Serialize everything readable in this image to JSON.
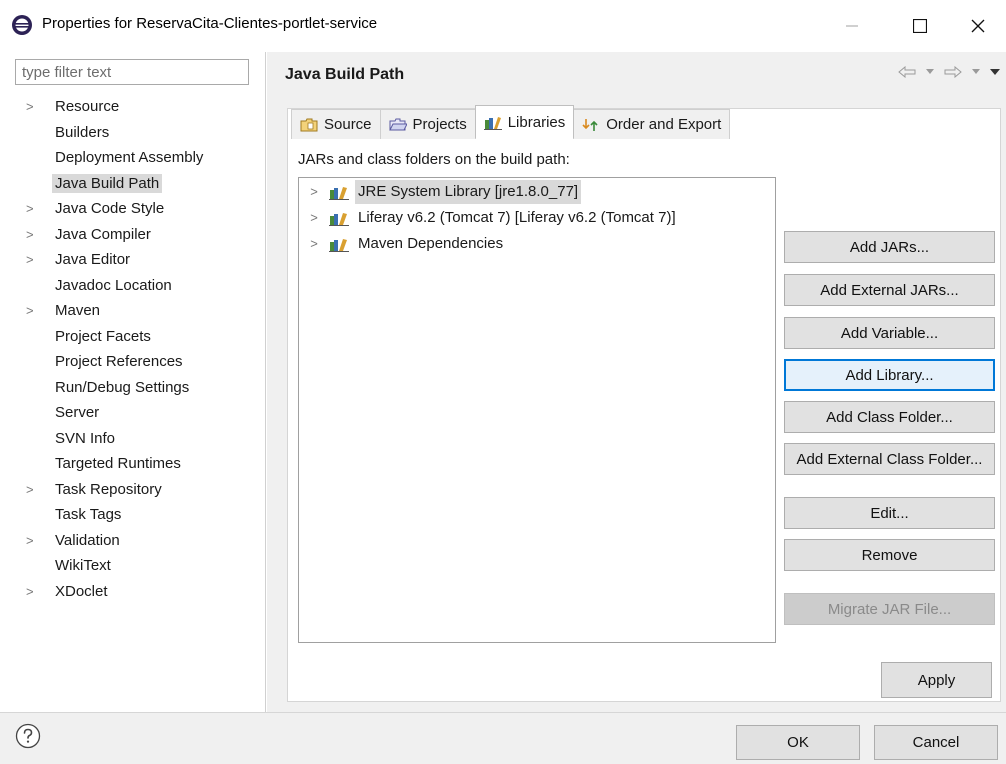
{
  "window": {
    "title": "Properties for ReservaCita-Clientes-portlet-service",
    "controls": {
      "minimize_icon": "minimize-icon",
      "maximize_icon": "maximize-icon",
      "close_icon": "close-icon"
    }
  },
  "filter": {
    "placeholder": "type filter text",
    "value": ""
  },
  "tree": {
    "items": [
      {
        "label": "Resource",
        "expandable": true,
        "selected": false
      },
      {
        "label": "Builders",
        "expandable": false,
        "selected": false
      },
      {
        "label": "Deployment Assembly",
        "expandable": false,
        "selected": false
      },
      {
        "label": "Java Build Path",
        "expandable": false,
        "selected": true
      },
      {
        "label": "Java Code Style",
        "expandable": true,
        "selected": false
      },
      {
        "label": "Java Compiler",
        "expandable": true,
        "selected": false
      },
      {
        "label": "Java Editor",
        "expandable": true,
        "selected": false
      },
      {
        "label": "Javadoc Location",
        "expandable": false,
        "selected": false
      },
      {
        "label": "Maven",
        "expandable": true,
        "selected": false
      },
      {
        "label": "Project Facets",
        "expandable": false,
        "selected": false
      },
      {
        "label": "Project References",
        "expandable": false,
        "selected": false
      },
      {
        "label": "Run/Debug Settings",
        "expandable": false,
        "selected": false
      },
      {
        "label": "Server",
        "expandable": false,
        "selected": false
      },
      {
        "label": "SVN Info",
        "expandable": false,
        "selected": false
      },
      {
        "label": "Targeted Runtimes",
        "expandable": false,
        "selected": false
      },
      {
        "label": "Task Repository",
        "expandable": true,
        "selected": false
      },
      {
        "label": "Task Tags",
        "expandable": false,
        "selected": false
      },
      {
        "label": "Validation",
        "expandable": true,
        "selected": false
      },
      {
        "label": "WikiText",
        "expandable": false,
        "selected": false
      },
      {
        "label": "XDoclet",
        "expandable": true,
        "selected": false
      }
    ]
  },
  "page": {
    "title": "Java Build Path"
  },
  "tabs": [
    {
      "label": "Source",
      "icon": "source-folder-icon",
      "active": false
    },
    {
      "label": "Projects",
      "icon": "projects-folder-icon",
      "active": false
    },
    {
      "label": "Libraries",
      "icon": "libraries-icon",
      "active": true
    },
    {
      "label": "Order and Export",
      "icon": "order-export-icon",
      "active": false
    }
  ],
  "libraries": {
    "label": "JARs and class folders on the build path:",
    "items": [
      {
        "label": "JRE System Library [jre1.8.0_77]",
        "selected": true
      },
      {
        "label": "Liferay v6.2 (Tomcat 7) [Liferay v6.2 (Tomcat 7)]",
        "selected": false
      },
      {
        "label": "Maven Dependencies",
        "selected": false
      }
    ]
  },
  "buttons": {
    "add_jars": "Add JARs...",
    "add_external_jars": "Add External JARs...",
    "add_variable": "Add Variable...",
    "add_library": "Add Library...",
    "add_class_folder": "Add Class Folder...",
    "add_external_class_folder": "Add External Class Folder...",
    "edit": "Edit...",
    "remove": "Remove",
    "migrate_jar": "Migrate JAR File...",
    "apply": "Apply",
    "ok": "OK",
    "cancel": "Cancel"
  },
  "colors": {
    "accent": "#0078d7",
    "selection": "#d9d9d9",
    "dialog_bg": "#f0f0f0"
  }
}
